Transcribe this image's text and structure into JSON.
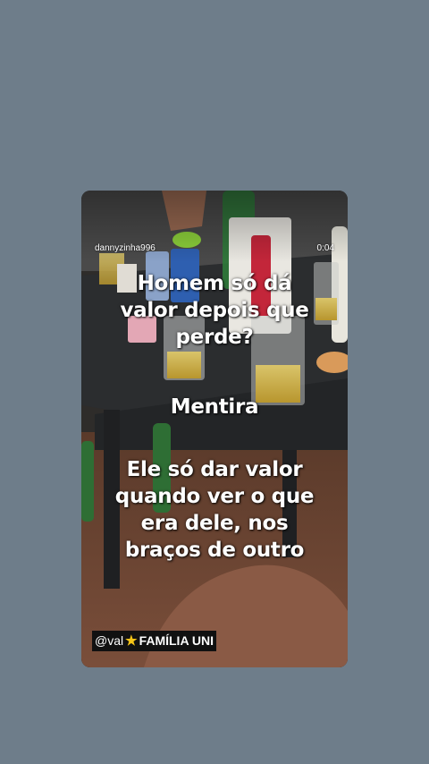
{
  "story": {
    "username": "dannyzinha996",
    "timestamp": "0:04"
  },
  "caption": {
    "question_lines": [
      "Homem só dá",
      "valor depois que",
      "perde?"
    ],
    "answer": "Mentira",
    "explanation_lines": [
      "Ele só dar valor",
      "quando ver o que",
      "era dele, nos",
      "braços de outro"
    ]
  },
  "tag": {
    "handle": "@val",
    "star_icon": "star-icon",
    "group": "FAMÍLIA UNI"
  },
  "colors": {
    "page_background": "#6e7d8a",
    "tag_background": "#111111",
    "star": "#f5c518"
  }
}
